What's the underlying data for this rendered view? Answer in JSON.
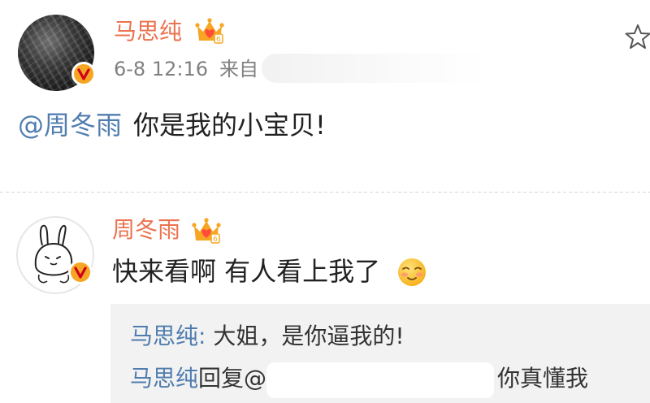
{
  "post": {
    "author": "马思纯",
    "time": "6-8 12:16",
    "source_prefix": "来自",
    "mention": "@周冬雨",
    "text": "你是我的小宝贝!"
  },
  "comment": {
    "author": "周冬雨",
    "text": "快来看啊 有人看上我了",
    "emoji": "blush-smile-emoji"
  },
  "replies": [
    {
      "name": "马思纯",
      "sep": ": ",
      "text": "大姐，是你逼我的!"
    },
    {
      "name": "马思纯",
      "action": "回复@",
      "tail": "你真懂我"
    }
  ],
  "colors": {
    "name": "#eb7350",
    "link": "#507daf",
    "badge": "#f5a623",
    "reply_bg": "#f2f2f2"
  },
  "icons": [
    "crown-vip-icon",
    "verified-badge-icon",
    "star-icon"
  ]
}
